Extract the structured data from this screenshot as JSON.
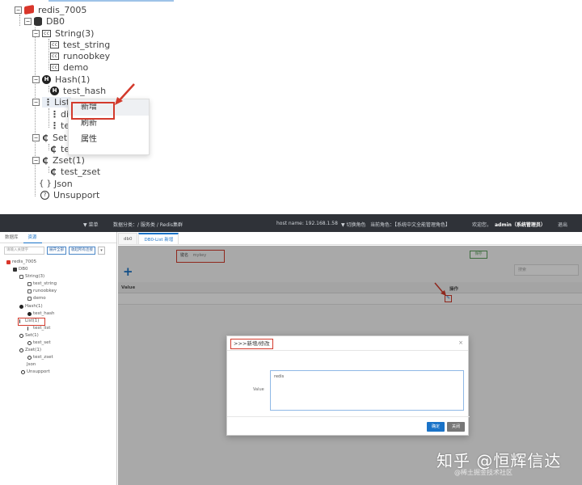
{
  "zoom_tree": {
    "root": "redis_7005",
    "db": "DB0",
    "string_group": "String(3)",
    "string_items": [
      "test_string",
      "runoobkey",
      "demo"
    ],
    "hash_group": "Hash(1)",
    "hash_item": "test_hash",
    "list_group": "List",
    "list_item_partials": [
      "di",
      "te"
    ],
    "set_group": "Set",
    "set_item_partial": "te",
    "zset_group": "Zset(1)",
    "zset_item": "test_zset",
    "json_node": "Json",
    "unsupport_node": "Unsupport"
  },
  "context_menu": {
    "items": [
      "新增",
      "刷新",
      "属性"
    ]
  },
  "app": {
    "header": {
      "left": "▼ 菜单",
      "breadcrumb": "数据分类：/ 服务类 / Redis集群",
      "host": "host name: 192.168.1.58",
      "role_switch": "▼ 切换角色",
      "role": "当前角色：【系统中文全能管理角色】",
      "greeting": "欢迎您，",
      "user": "admin（系统管理员）",
      "logout": "退出"
    },
    "left_tabs": [
      "数据库",
      "资源"
    ],
    "left_search_placeholder": "请输入关键字",
    "left_buttons": [
      "展开全部",
      "收起所有连接"
    ],
    "left_more": "▾",
    "tree": {
      "root": "redis_7005",
      "db": "DB0",
      "string_group": "String(3)",
      "string_items": [
        "test_string",
        "runoobkey",
        "demo"
      ],
      "hash_group": "Hash(1)",
      "hash_item": "test_hash",
      "list_group": "List(1)",
      "list_item": "test_list",
      "set_group": "Set(1)",
      "set_item": "test_set",
      "zset_group": "Zset(1)",
      "zset_item": "test_zset",
      "json_node": "Json",
      "unsupport_node": "Unsupport"
    },
    "tabs": [
      "db0",
      "DB0-List 新增"
    ],
    "key_label": "键名",
    "key_value": "mykey",
    "save_label": "保存",
    "search_placeholder": "搜索",
    "col_value": "Value",
    "col_action": "操作",
    "modal": {
      "title": ">>>新增/修改",
      "close": "×",
      "value_label": "Value",
      "value_text": "redis",
      "ok": "确定",
      "cancel": "关闭"
    },
    "watermark": "知乎 @恒辉信达",
    "watermark_sub": "@稀土掘金技术社区"
  },
  "colors": {
    "highlight_red": "#d33a2c",
    "primary_blue": "#1a73c8",
    "header_dark": "#2f3238"
  }
}
